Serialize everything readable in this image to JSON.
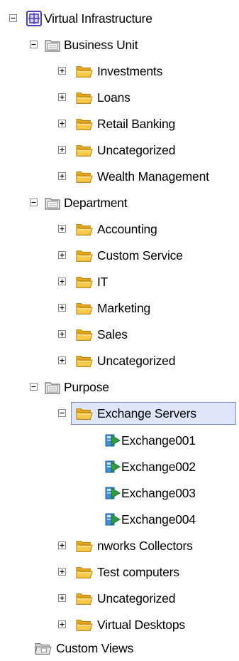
{
  "tree": {
    "root": {
      "label": "Virtual Infrastructure",
      "icon": "datacenter-icon",
      "expanded": true,
      "groups": [
        {
          "label": "Business Unit",
          "icon": "category-folder-icon",
          "expanded": true,
          "children": [
            {
              "label": "Investments",
              "icon": "folder-icon",
              "expanded": false
            },
            {
              "label": "Loans",
              "icon": "folder-icon",
              "expanded": false
            },
            {
              "label": "Retail Banking",
              "icon": "folder-icon",
              "expanded": false
            },
            {
              "label": "Uncategorized",
              "icon": "folder-icon",
              "expanded": false
            },
            {
              "label": "Wealth Management",
              "icon": "folder-icon",
              "expanded": false
            }
          ]
        },
        {
          "label": "Department",
          "icon": "category-folder-icon",
          "expanded": true,
          "children": [
            {
              "label": "Accounting",
              "icon": "folder-icon",
              "expanded": false
            },
            {
              "label": "Custom Service",
              "icon": "folder-icon",
              "expanded": false
            },
            {
              "label": "IT",
              "icon": "folder-icon",
              "expanded": false
            },
            {
              "label": "Marketing",
              "icon": "folder-icon",
              "expanded": false
            },
            {
              "label": "Sales",
              "icon": "folder-icon",
              "expanded": false
            },
            {
              "label": "Uncategorized",
              "icon": "folder-icon",
              "expanded": false
            }
          ]
        },
        {
          "label": "Purpose",
          "icon": "category-folder-icon",
          "expanded": true,
          "children": [
            {
              "label": "Exchange Servers",
              "icon": "folder-icon",
              "expanded": true,
              "selected": true,
              "children": [
                {
                  "label": "Exchange001",
                  "icon": "virtual-machine-icon"
                },
                {
                  "label": "Exchange002",
                  "icon": "virtual-machine-icon"
                },
                {
                  "label": "Exchange003",
                  "icon": "virtual-machine-icon"
                },
                {
                  "label": "Exchange004",
                  "icon": "virtual-machine-icon"
                }
              ]
            },
            {
              "label": "nworks Collectors",
              "icon": "folder-icon",
              "expanded": false
            },
            {
              "label": "Test computers",
              "icon": "folder-icon",
              "expanded": false
            },
            {
              "label": "Uncategorized",
              "icon": "folder-icon",
              "expanded": false
            },
            {
              "label": "Virtual Desktops",
              "icon": "folder-icon",
              "expanded": false
            }
          ]
        }
      ]
    },
    "custom_views": {
      "label": "Custom Views",
      "icon": "custom-views-icon"
    }
  },
  "colors": {
    "selection_border": "#7f8fc9",
    "selection_fill": "#dfe6fb",
    "folder_yellow": "#f6c94a",
    "datacenter_blue": "#4a3fc0",
    "vm_green": "#2e9b46",
    "vm_blue": "#3f8fd8"
  }
}
